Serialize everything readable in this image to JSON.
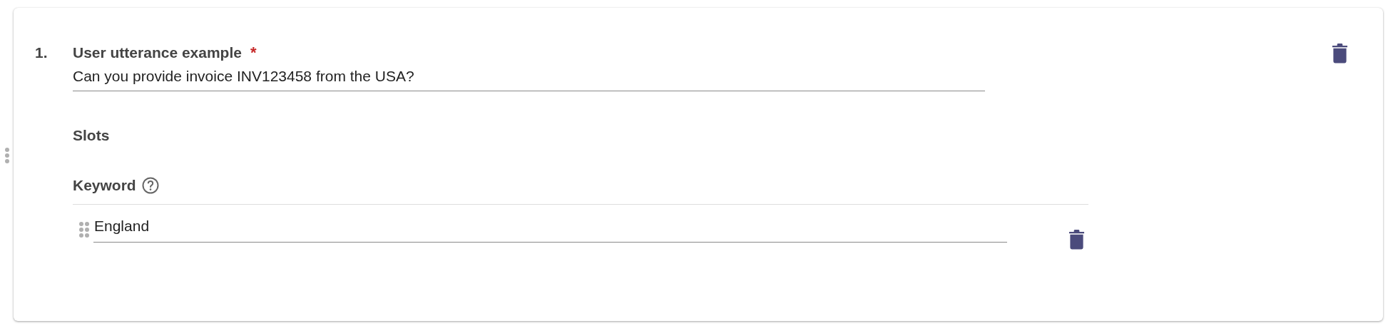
{
  "examples": [
    {
      "number": "1.",
      "label": "User utterance example",
      "required_mark": "*",
      "value": "Can you provide invoice INV123458 from the USA?",
      "slots_heading": "Slots",
      "slots": [
        {
          "name": "Keyword",
          "values": [
            "England"
          ]
        }
      ]
    }
  ]
}
